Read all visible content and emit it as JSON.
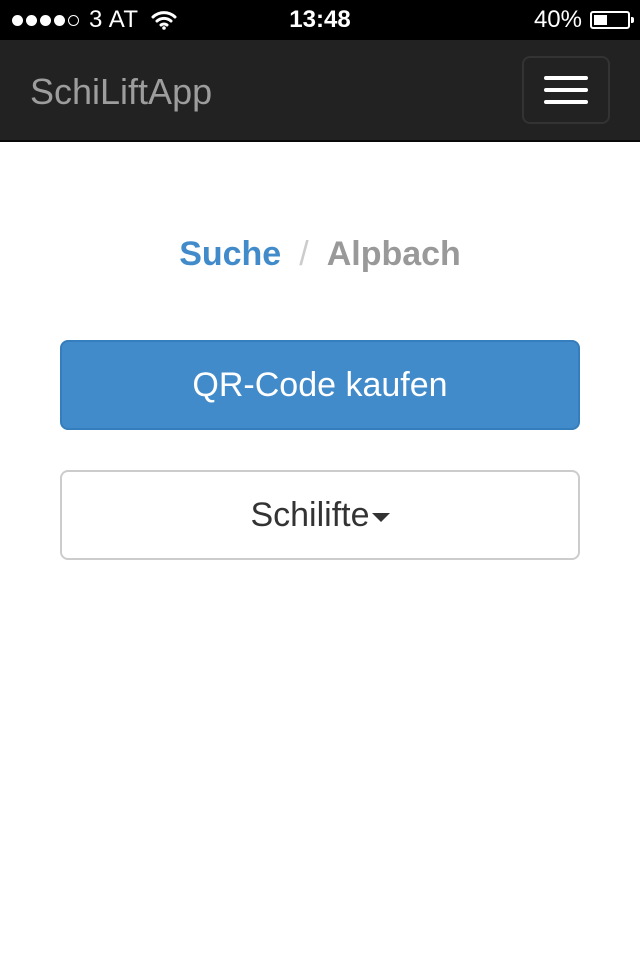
{
  "status_bar": {
    "carrier": "3 AT",
    "time": "13:48",
    "battery_percent": "40%",
    "battery_level": 0.4,
    "signal_strength": 4,
    "signal_max": 5
  },
  "navbar": {
    "brand": "SchiLiftApp",
    "menu_icon": "hamburger-menu-icon"
  },
  "breadcrumb": {
    "items": [
      "Suche",
      "Alpbach"
    ],
    "separator": "/"
  },
  "actions": {
    "qr_button_label": "QR-Code kaufen",
    "lifts_dropdown_label": "Schilifte"
  },
  "colors": {
    "navbar_bg": "#222222",
    "brand_text": "#9d9d9d",
    "primary": "#428bca",
    "breadcrumb_active": "#999999"
  }
}
